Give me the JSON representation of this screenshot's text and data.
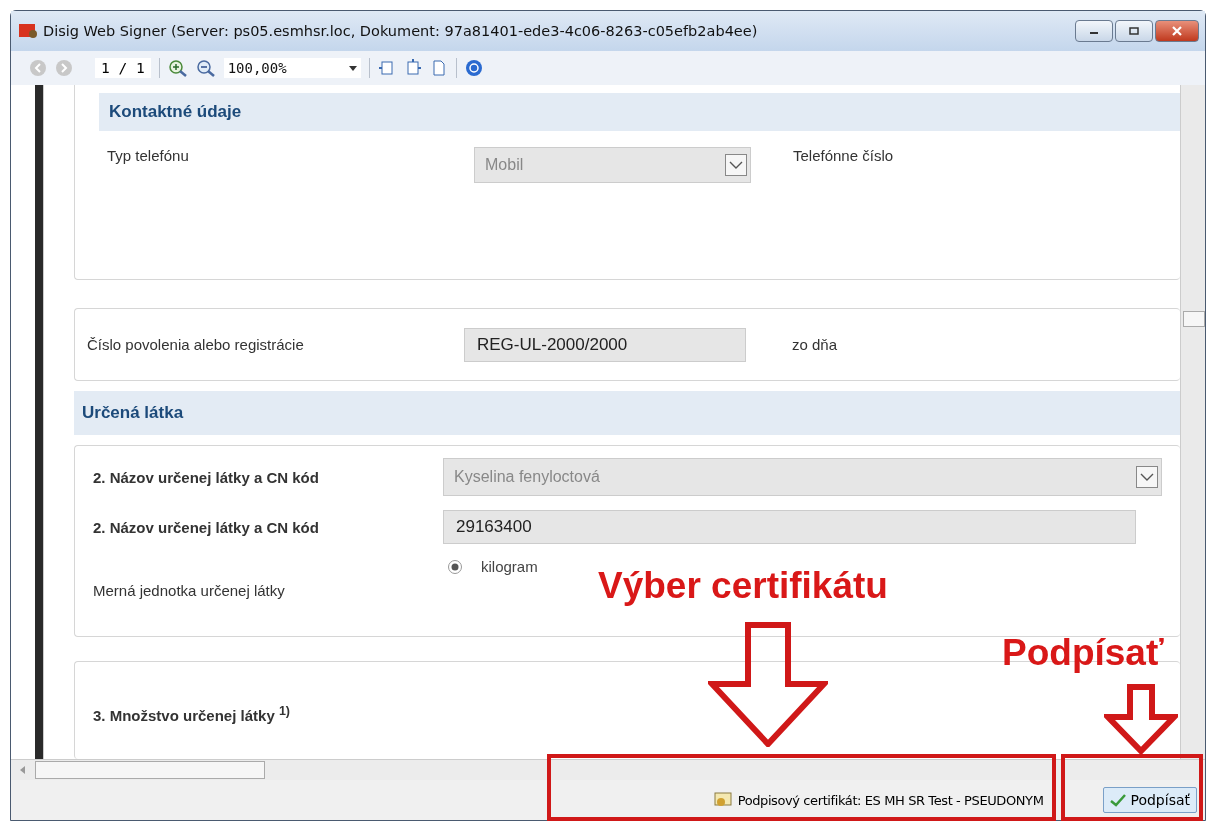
{
  "window": {
    "title": "Disig Web Signer (Server: ps05.esmhsr.loc, Dokument: 97a81401-ede3-4c06-8263-c05efb2ab4ee)"
  },
  "toolbar": {
    "page": "1 / 1",
    "zoom": "100,00%"
  },
  "contact": {
    "heading": "Kontaktné údaje",
    "phone_type_label": "Typ telefónu",
    "phone_type_value": "Mobil",
    "phone_number_label": "Telefónne číslo"
  },
  "permit": {
    "label": "Číslo povolenia alebo registrácie",
    "value": "REG-UL-2000/2000",
    "date_label": "zo dňa"
  },
  "substance": {
    "heading": "Určená látka",
    "name_label": "2. Názov určenej látky a CN kód",
    "name_value": "Kyselina fenyloctová",
    "code_label": "2. Názov určenej látky a CN kód",
    "code_value": "29163400",
    "unit_label": "Merná jednotka určenej látky",
    "units": [
      {
        "label": "kilogram",
        "selected": true
      }
    ]
  },
  "quantity": {
    "label": "3. Množstvo určenej látky $^{1)}$"
  },
  "status_bar": {
    "certificate": "Podpisový certifikát: ES MH SR Test - PSEUDONYM",
    "sign_button": "Podpísať"
  },
  "annotations": {
    "certificate_callout": "Výber certifikátu",
    "sign_callout": "Podpísať"
  }
}
